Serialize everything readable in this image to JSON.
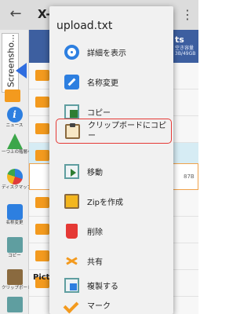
{
  "appbar": {
    "back_icon": "arrow-left-icon",
    "title": "X-p",
    "overflow_icon": "more-vert-icon"
  },
  "left_panel": {
    "tab_label": "Screensho...",
    "tools": [
      {
        "icon": "info-icon",
        "label": "ニュース"
      },
      {
        "icon": "up-arrow-icon",
        "label": "一つ上の階層へ移動"
      },
      {
        "icon": "disk-map-icon",
        "label": "ディスクマップ"
      },
      {
        "icon": "rename-icon",
        "label": "名称変更"
      },
      {
        "icon": "copy-icon",
        "label": "コピー"
      },
      {
        "icon": "clipboard-icon",
        "label": "クリップボードにコピー"
      }
    ]
  },
  "content": {
    "drive_label": "ts",
    "drive_free": "空き容量 3B/49GB",
    "file_size": "87B",
    "bottom_folder": "Pictures"
  },
  "context_menu": {
    "title": "upload.txt",
    "items": [
      {
        "icon": "info-icon",
        "label": "詳細を表示"
      },
      {
        "icon": "rename-icon",
        "label": "名称変更"
      },
      {
        "icon": "copy-icon",
        "label": "コピー"
      },
      {
        "icon": "clipboard-icon",
        "label": "クリップボードにコピー",
        "highlighted": true
      },
      {
        "icon": "move-icon",
        "label": "移動"
      },
      {
        "icon": "zip-icon",
        "label": "Zipを作成"
      },
      {
        "icon": "delete-icon",
        "label": "削除"
      },
      {
        "icon": "share-icon",
        "label": "共有"
      },
      {
        "icon": "duplicate-icon",
        "label": "複製する"
      },
      {
        "icon": "check-mark-icon",
        "label": "マーク"
      }
    ],
    "highlight_color": "#e53935"
  }
}
